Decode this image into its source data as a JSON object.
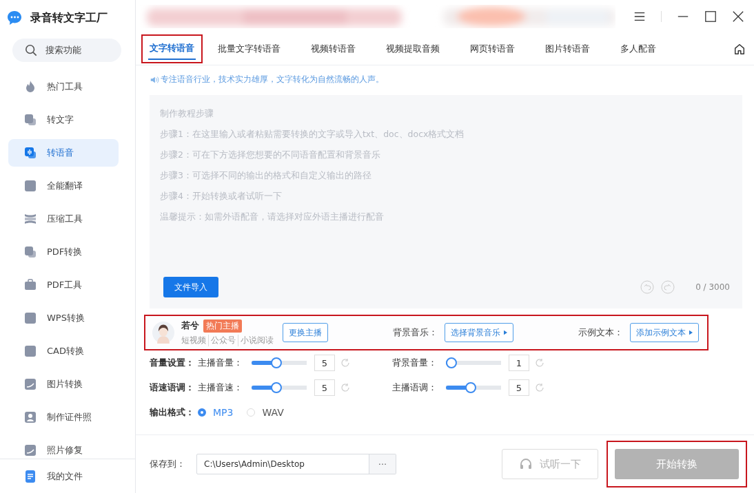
{
  "app": {
    "title": "录音转文字工厂"
  },
  "sidebar": {
    "search": "搜索功能",
    "items": [
      {
        "label": "热门工具",
        "selected": false
      },
      {
        "label": "转文字",
        "selected": false
      },
      {
        "label": "转语音",
        "selected": true
      },
      {
        "label": "全能翻译",
        "selected": false
      },
      {
        "label": "压缩工具",
        "selected": false
      },
      {
        "label": "PDF转换",
        "selected": false
      },
      {
        "label": "PDF工具",
        "selected": false
      },
      {
        "label": "WPS转换",
        "selected": false
      },
      {
        "label": "CAD转换",
        "selected": false
      },
      {
        "label": "图片转换",
        "selected": false
      },
      {
        "label": "制作证件照",
        "selected": false
      },
      {
        "label": "照片修复",
        "selected": false
      }
    ],
    "footer": "我的文件"
  },
  "tabs": [
    {
      "label": "文字转语音",
      "selected": true,
      "highlighted": true
    },
    {
      "label": "批量文字转语音",
      "selected": false,
      "highlighted": false
    },
    {
      "label": "视频转语音",
      "selected": false,
      "highlighted": false
    },
    {
      "label": "视频提取音频",
      "selected": false,
      "highlighted": false
    },
    {
      "label": "网页转语音",
      "selected": false,
      "highlighted": false
    },
    {
      "label": "图片转语音",
      "selected": false,
      "highlighted": false
    },
    {
      "label": "多人配音",
      "selected": false,
      "highlighted": false
    }
  ],
  "tagline": "专注语音行业，技术实力雄厚，文字转化为自然流畅的人声。",
  "editor": {
    "placeholder_lines": [
      "制作教程步骤",
      "步骤1：在这里输入或者粘贴需要转换的文字或导入txt、doc、docx格式文档",
      "步骤2：可在下方选择您想要的不同语音配置和背景音乐",
      "步骤3：可选择不同的输出的格式和自定义输出的路径",
      "步骤4：开始转换或者试听一下",
      "温馨提示：如需外语配音，请选择对应外语主播进行配音"
    ],
    "import_button": "文件导入",
    "counter": "0 / 3000"
  },
  "anchor_bar": {
    "highlighted": true,
    "name": "若兮",
    "badge": "热门主播",
    "tags": [
      "短视频",
      "公众号",
      "小说阅读"
    ],
    "change_button": "更换主播",
    "music_label": "背景音乐：",
    "music_button": "选择背景音乐",
    "sample_label": "示例文本：",
    "sample_button": "添加示例文本"
  },
  "settings": [
    {
      "group": "音量设置：",
      "controls": [
        {
          "label": "主播音量：",
          "level": 0.44,
          "value": "5"
        },
        {
          "label": "背景音量：",
          "level": 0,
          "value": "1"
        }
      ]
    },
    {
      "group": "语速语调：",
      "controls": [
        {
          "label": "主播音速：",
          "level": 0.44,
          "value": "5"
        },
        {
          "label": "主播语调：",
          "level": 0.44,
          "value": "5"
        }
      ]
    }
  ],
  "output": {
    "label": "输出格式：",
    "options": [
      {
        "label": "MP3",
        "selected": true
      },
      {
        "label": "WAV",
        "selected": false
      }
    ]
  },
  "save": {
    "label": "保存到：",
    "path": "C:\\Users\\Admin\\Desktop",
    "browse": "···"
  },
  "preview_button": {
    "label": "试听一下",
    "disabled": true
  },
  "start_button": {
    "label": "开始转换",
    "disabled": true,
    "highlighted": true
  }
}
